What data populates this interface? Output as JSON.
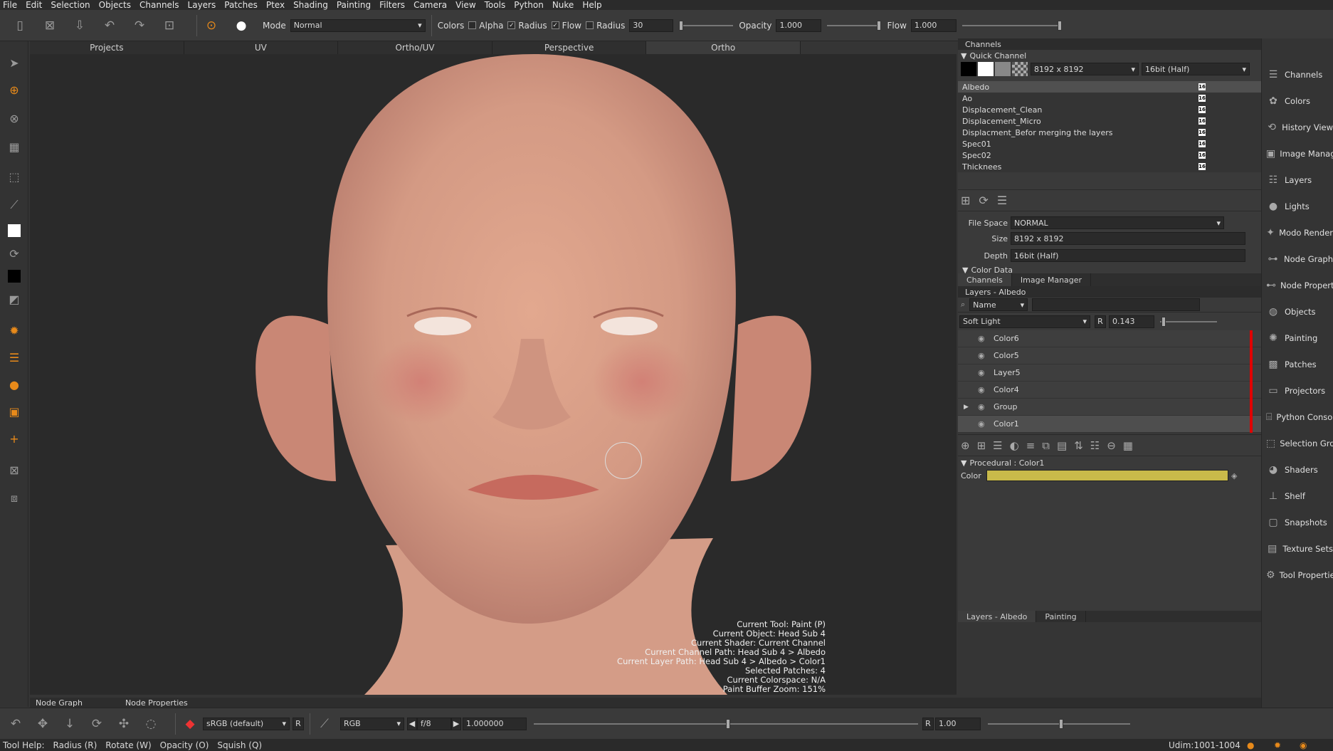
{
  "menu": [
    "File",
    "Edit",
    "Selection",
    "Objects",
    "Channels",
    "Layers",
    "Patches",
    "Ptex",
    "Shading",
    "Painting",
    "Filters",
    "Camera",
    "View",
    "Tools",
    "Python",
    "Nuke",
    "Help"
  ],
  "toolbar": {
    "mode_label": "Mode",
    "mode_value": "Normal",
    "colors_label": "Colors",
    "alpha_label": "Alpha",
    "radius_label": "Radius",
    "flow_label": "Flow",
    "radius2_label": "Radius",
    "radius_value": "30",
    "opacity_label": "Opacity",
    "opacity_value": "1.000",
    "flow2_label": "Flow",
    "flow_value": "1.000"
  },
  "viewport_tabs": [
    "Projects",
    "UV",
    "Ortho/UV",
    "Perspective",
    "Ortho"
  ],
  "viewport_info": [
    "Current Tool: Paint (P)",
    "Current Object: Head Sub 4",
    "Current Shader: Current Channel",
    "Current Channel Path: Head Sub 4 > Albedo",
    "Current Layer Path: Head Sub 4 > Albedo > Color1",
    "Selected Patches: 4",
    "Current Colorspace: N/A",
    "Paint Buffer Zoom: 151%"
  ],
  "channels_panel": {
    "title": "Channels",
    "quick_channel": "Quick Channel",
    "size": "8192 x 8192",
    "depth": "16bit (Half)",
    "items": [
      "Albedo",
      "Ao",
      "Displacement_Clean",
      "Displacement_Micro",
      "Displacment_Befor merging the layers",
      "Spec01",
      "Spec02",
      "Thicknees"
    ],
    "badge": "16",
    "file_space_label": "File Space",
    "file_space_value": "NORMAL",
    "size_label": "Size",
    "size_value": "8192 x 8192",
    "depth_label": "Depth",
    "depth_value": "16bit (Half)",
    "color_data": "Color Data",
    "tabs": [
      "Channels",
      "Image Manager"
    ]
  },
  "layers_panel": {
    "title": "Layers - Albedo",
    "filter_mode": "Name",
    "blend_mode": "Soft Light",
    "r_label": "R",
    "opacity_value": "0.143",
    "layers": [
      "Color6",
      "Color5",
      "Layer5",
      "Color4",
      "Group",
      "Color1"
    ],
    "procedural_title": "Procedural : Color1",
    "color_label": "Color",
    "color_swatch": "#c9ba4a",
    "bottom_tabs": [
      "Layers - Albedo",
      "Painting"
    ]
  },
  "sidebar": [
    "Channels",
    "Colors",
    "History View",
    "Image Manager",
    "Layers",
    "Lights",
    "Modo Render",
    "Node Graph",
    "Node Properties",
    "Objects",
    "Painting",
    "Patches",
    "Projectors",
    "Python Console",
    "Selection Groups",
    "Shaders",
    "Shelf",
    "Snapshots",
    "Texture Sets",
    "Tool Properties"
  ],
  "bottom_tabs": [
    "Node Graph",
    "Node Properties"
  ],
  "bottombar": {
    "colorspace": "sRGB (default)",
    "r_label": "R",
    "channels_mode": "RGB",
    "fstop": "f/8",
    "gain": "1.000000",
    "r2_label": "R",
    "gamma": "1.00"
  },
  "status": {
    "help": [
      "Tool Help:",
      "Radius (R)",
      "Rotate (W)",
      "Opacity (O)",
      "Squish (Q)"
    ],
    "udim": "Udim:1001-1004"
  }
}
